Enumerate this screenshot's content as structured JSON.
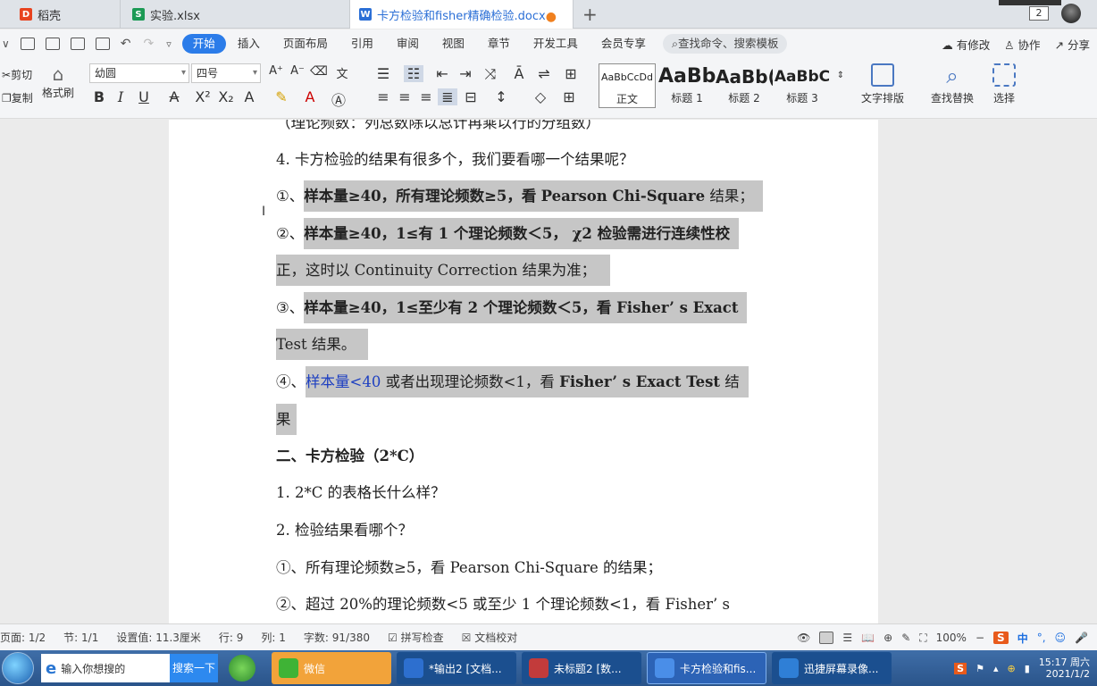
{
  "tabs": [
    {
      "label": "稻壳",
      "color": "#e8431f",
      "glyph": "D"
    },
    {
      "label": "实验.xlsx",
      "color": "#1c9a55",
      "glyph": "S"
    },
    {
      "label": "卡方检验和fisher精确检验.docx",
      "color": "#2b6fd6",
      "glyph": "W",
      "active": true
    }
  ],
  "new_tab": "+",
  "window_count": "2",
  "menu": {
    "items": [
      "开始",
      "插入",
      "页面布局",
      "引用",
      "审阅",
      "视图",
      "章节",
      "开发工具",
      "会员专享"
    ],
    "search": "查找命令、搜索模板",
    "right": [
      "有修改",
      "协作",
      "分享"
    ]
  },
  "ribbon": {
    "cut": "剪切",
    "copy": "复制",
    "format_painter": "格式刷",
    "font_name": "幼圆",
    "font_size": "四号",
    "styles": [
      {
        "sample": "AaBbCcDd",
        "label": "正文"
      },
      {
        "sample": "AaBb",
        "label": "标题 1"
      },
      {
        "sample": "AaBb(",
        "label": "标题 2"
      },
      {
        "sample": "AaBbC",
        "label": "标题 3"
      }
    ],
    "text_layout": "文字排版",
    "find_replace": "查找替换",
    "select": "选择"
  },
  "document": {
    "line0": "（理论频数：列总数除以总计再乘以行的分组数）",
    "line1": "4. 卡方检验的结果有很多个，我们要看哪一个结果呢？",
    "line2a": "①、",
    "line2b": "样本量≥40，所有理论频数≥5，看",
    "line2c": "Pearson Chi-Square",
    "line2d": "结果；",
    "line3a": "②、",
    "line3b": "样本量≥40，1≤有 1 个理论频数＜5， χ2 检验需进行连续性校",
    "line4": "正，这时以 Continuity Correction 结果为准；",
    "line5a": "③、",
    "line5b": "样本量≥40，1≤至少有 2 个理论频数＜5，看 Fisher’ s Exact",
    "line6": "Test 结果。",
    "line7a": "④、",
    "line7b": "样本量<40",
    "line7c": " 或者出现理论频数<1，看 ",
    "line7d": "Fisher’ s Exact Test",
    "line7e": " 结",
    "line8": "果",
    "heading2": "二、卡方检验（2*C）",
    "q1": "1. 2*C 的表格长什么样？",
    "q2": "2. 检验结果看哪个？",
    "a1": "①、所有理论频数≥5，看 Pearson Chi-Square 的结果；",
    "a2": "②、超过 20%的理论频数<5 或至少 1 个理论频数<1，看 Fisher’ s"
  },
  "status": {
    "page": "页面: 1/2",
    "section": "节: 1/1",
    "setting": "设置值: 11.3厘米",
    "row": "行: 9",
    "col": "列: 1",
    "words": "字数: 91/380",
    "spell": "拼写检查",
    "proof": "文档校对",
    "zoom": "100%"
  },
  "taskbar": {
    "search_placeholder": "输入你想搜的",
    "search_button": "搜索一下",
    "apps": [
      {
        "label": "微信",
        "color": "#f2a33a"
      },
      {
        "label": "*输出2 [文档...",
        "color": "#1b4f8f"
      },
      {
        "label": "未标题2 [数...",
        "color": "#1b4f8f"
      },
      {
        "label": "卡方检验和fis...",
        "color": "#2c63b6"
      },
      {
        "label": "迅捷屏幕录像...",
        "color": "#1b4f8f"
      }
    ],
    "ime": "中",
    "time": "15:17 周六",
    "date": "2021/1/2"
  }
}
